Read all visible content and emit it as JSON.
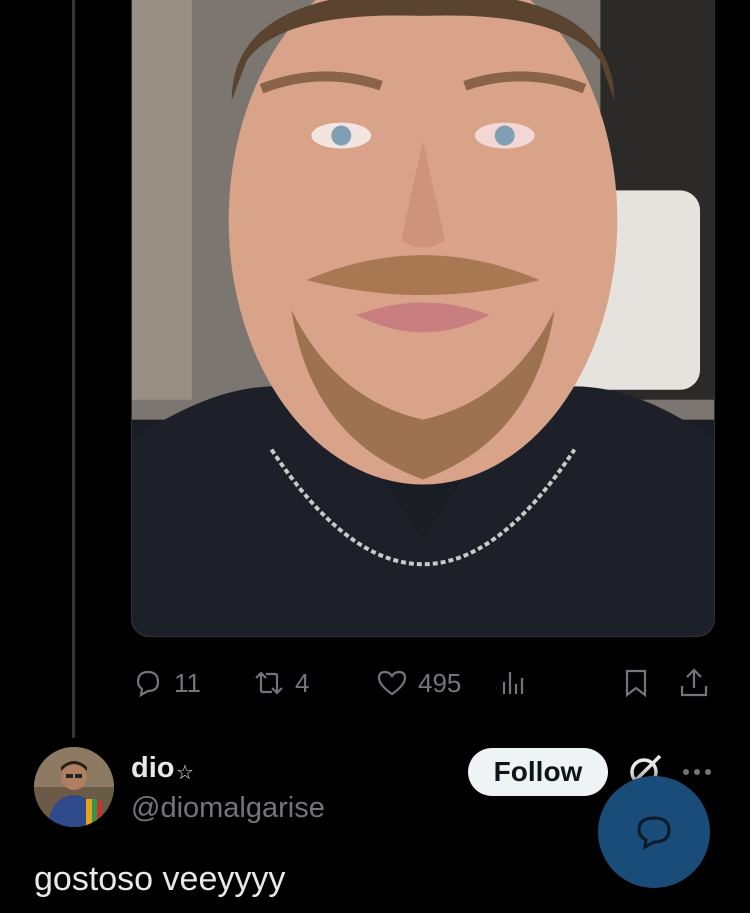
{
  "post": {
    "actions": {
      "replies": "11",
      "reposts": "4",
      "likes": "495"
    }
  },
  "reply": {
    "display_name": "dio",
    "badge_icon": "star-icon",
    "handle": "@diomalgarise",
    "follow_label": "Follow",
    "text": "gostoso veeyyyy"
  },
  "icons": {
    "reply": "reply-icon",
    "repost": "repost-icon",
    "like": "heart-icon",
    "views": "views-icon",
    "bookmark": "bookmark-icon",
    "share": "share-icon",
    "grok": "grok-icon",
    "more": "more-icon",
    "compose": "compose-reply-icon"
  },
  "colors": {
    "background": "#000000",
    "muted": "#71767b",
    "text": "#e7e9ea",
    "follow_bg": "#eff3f4",
    "fab": "#1a4c7a"
  }
}
